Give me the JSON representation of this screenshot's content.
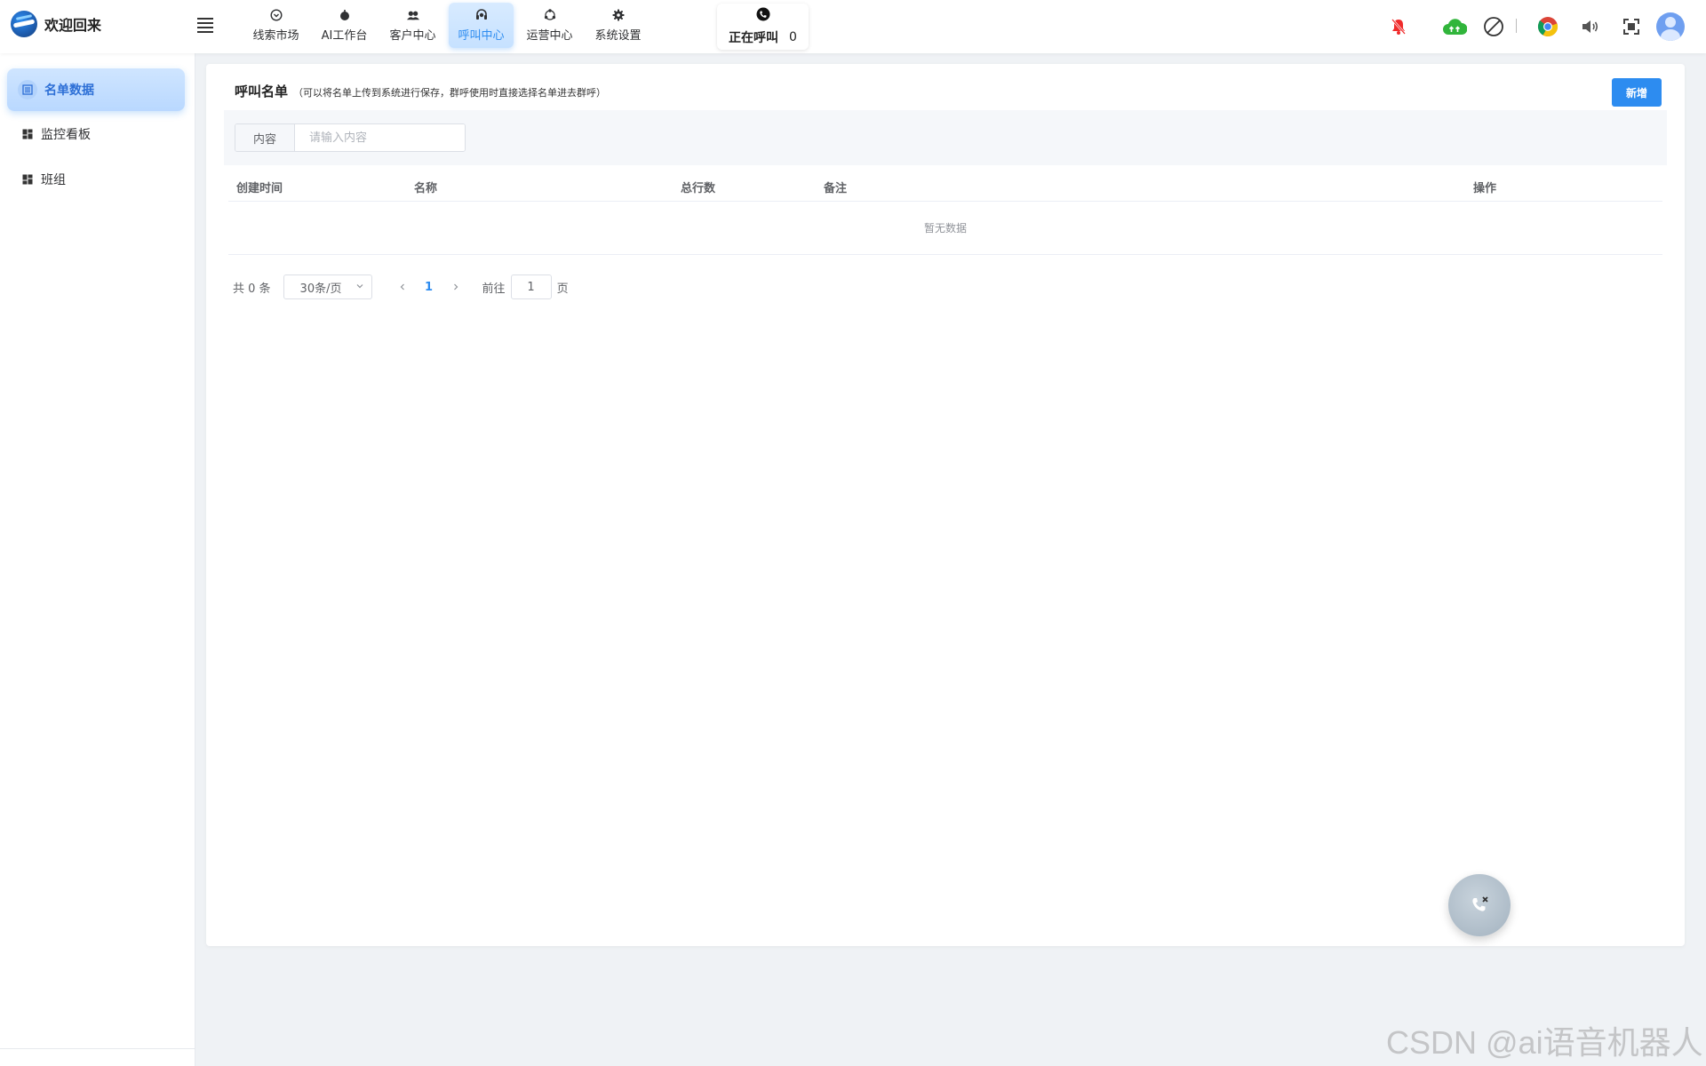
{
  "header": {
    "brand": "欢迎回来",
    "nav": [
      {
        "label": "线索市场",
        "icon": "chevron-circle-icon"
      },
      {
        "label": "AI工作台",
        "icon": "robot-icon"
      },
      {
        "label": "客户中心",
        "icon": "users-icon"
      },
      {
        "label": "呼叫中心",
        "icon": "headset-icon",
        "active": true
      },
      {
        "label": "运营中心",
        "icon": "cycle-icon"
      },
      {
        "label": "系统设置",
        "icon": "gear-icon"
      }
    ],
    "calling": {
      "label": "正在呼叫",
      "count": "0"
    },
    "right_icons": [
      "bell-off-icon",
      "cloud-upload-icon",
      "disabled-icon",
      "chrome-icon",
      "volume-icon",
      "fullscreen-icon"
    ]
  },
  "sidebar": {
    "items": [
      {
        "label": "名单数据",
        "icon": "list-icon",
        "active": true
      },
      {
        "label": "监控看板",
        "icon": "dashboard-icon"
      },
      {
        "label": "班组",
        "icon": "dashboard-icon"
      }
    ]
  },
  "main": {
    "title": "呼叫名单",
    "subtitle": "（可以将名单上传到系统进行保存，群呼使用时直接选择名单进去群呼）",
    "add_button": "新增",
    "search": {
      "label": "内容",
      "placeholder": "请输入内容",
      "value": ""
    },
    "table": {
      "columns": [
        "创建时间",
        "名称",
        "总行数",
        "备注",
        "操作"
      ],
      "rows": [],
      "empty_text": "暂无数据"
    },
    "pagination": {
      "total": "共 0 条",
      "page_size": "30条/页",
      "current_page": "1",
      "goto_label": "前往",
      "goto_value": "1",
      "page_suffix": "页"
    }
  },
  "fab": {
    "icon": "phone-hangup-icon"
  },
  "watermark": "CSDN @ai语音机器人",
  "colors": {
    "accent": "#2d8cf0",
    "background": "#eff2f5"
  }
}
